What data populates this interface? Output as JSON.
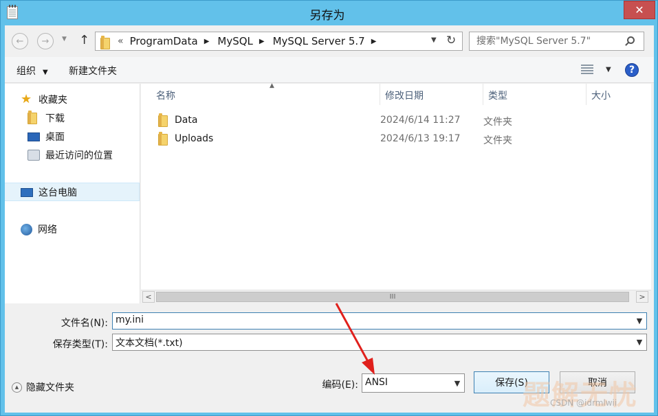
{
  "window": {
    "title": "另存为",
    "close_glyph": "✕"
  },
  "nav": {
    "back_glyph": "←",
    "forward_glyph": "→",
    "up_glyph": "↑",
    "overflow": "«",
    "breadcrumbs": [
      "ProgramData",
      "MySQL",
      "MySQL Server 5.7"
    ],
    "refresh_glyph": "↻",
    "search_placeholder": "搜索\"MySQL Server 5.7\""
  },
  "toolbar": {
    "organize_label": "组织",
    "new_folder_label": "新建文件夹",
    "help_glyph": "?"
  },
  "sidebar": {
    "favorites": "收藏夹",
    "downloads": "下载",
    "desktop": "桌面",
    "recent": "最近访问的位置",
    "this_pc": "这台电脑",
    "network": "网络"
  },
  "columns": {
    "name": "名称",
    "date": "修改日期",
    "type": "类型",
    "size": "大小"
  },
  "files": [
    {
      "name": "Data",
      "date": "2024/6/14 11:27",
      "type": "文件夹"
    },
    {
      "name": "Uploads",
      "date": "2024/6/13 19:17",
      "type": "文件夹"
    }
  ],
  "scrollbar": {
    "left_glyph": "<",
    "right_glyph": ">",
    "thumb_grip": "III"
  },
  "form": {
    "filename_label": "文件名(N):",
    "filename_value": "my.ini",
    "filetype_label": "保存类型(T):",
    "filetype_value": "文本文档(*.txt)",
    "encoding_label": "编码(E):",
    "encoding_value": "ANSI",
    "hide_folders_label": "隐藏文件夹",
    "save_label": "保存(S)",
    "cancel_label": "取消"
  },
  "watermark": {
    "text": "题解无忧",
    "sub": "CSDN @idrmlwii"
  },
  "colors": {
    "title_bar": "#62c1ea",
    "close": "#c75050",
    "annotation_arrow": "#e0201c"
  }
}
